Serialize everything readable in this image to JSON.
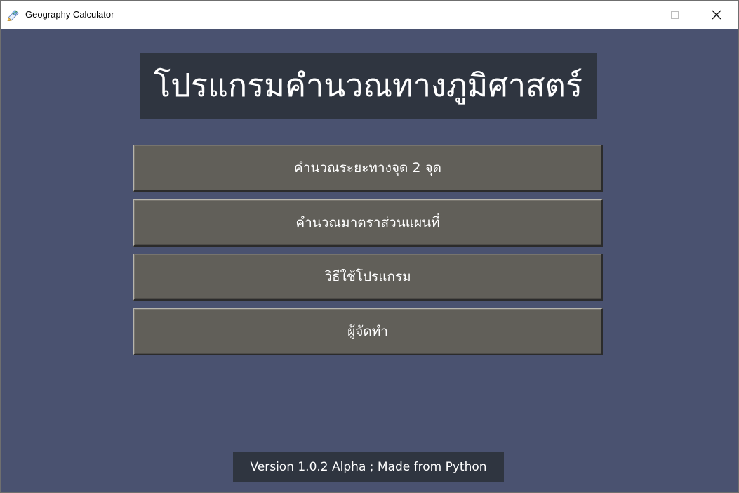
{
  "window": {
    "title": "Geography Calculator",
    "app_icon": "geography-calculator-app-icon",
    "controls": {
      "minimize": "minimize-icon",
      "maximize": "maximize-icon",
      "close": "close-icon"
    }
  },
  "main": {
    "heading": "โปรแกรมคำนวณทางภูมิศาสตร์",
    "buttons": [
      {
        "label": "คำนวณระยะทางจุด 2 จุด"
      },
      {
        "label": "คำนวณมาตราส่วนแผนที่"
      },
      {
        "label": "วิธีใช้โปรแกรม"
      },
      {
        "label": "ผู้จัดทำ"
      }
    ],
    "footer": "Version 1.0.2 Alpha ; Made from Python"
  },
  "colors": {
    "window_background": "#4a5270",
    "heading_background": "#2f3540",
    "button_background": "#615f59",
    "text": "#ffffff"
  }
}
